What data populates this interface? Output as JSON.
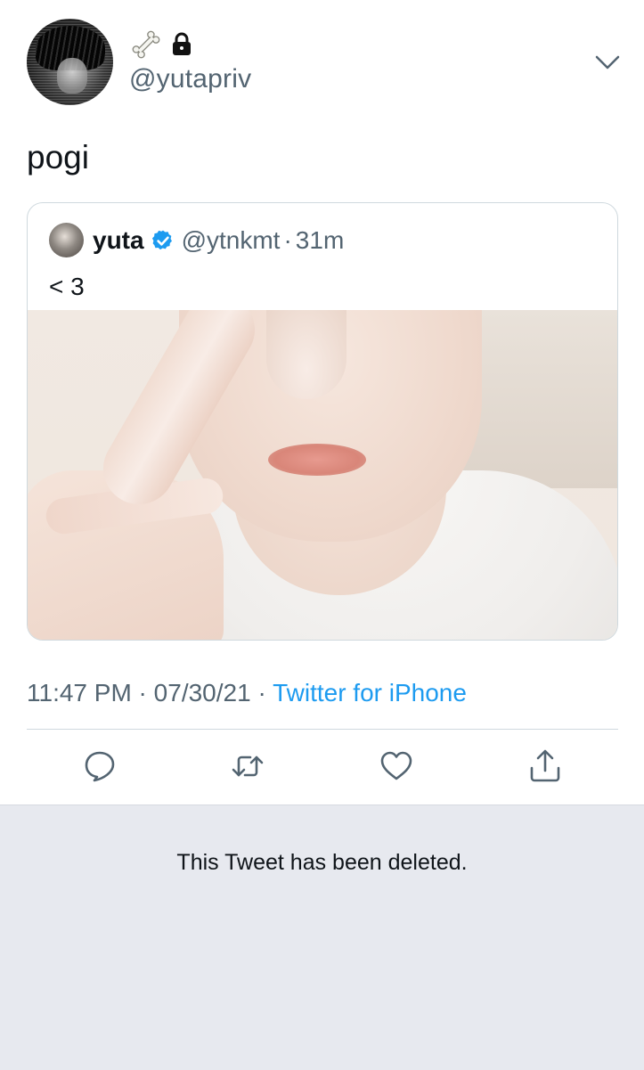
{
  "author": {
    "handle": "@yutapriv",
    "name_icons": [
      "bone-icon",
      "lock-icon"
    ]
  },
  "tweet": {
    "text": "pogi"
  },
  "quoted_tweet": {
    "name": "yuta",
    "handle": "@ytnkmt",
    "separator": "·",
    "time": "31m",
    "text": "< 3",
    "verified_color": "#1d9bf0"
  },
  "meta": {
    "time": "11:47 PM",
    "sep1": " · ",
    "date": "07/30/21",
    "sep2": " · ",
    "source": "Twitter for iPhone"
  },
  "actions": [
    "reply-icon",
    "retweet-icon",
    "like-icon",
    "share-icon"
  ],
  "deleted_notice": {
    "text": "This Tweet has been deleted."
  },
  "colors": {
    "accent": "#1d9bf0",
    "secondary_text": "#536471",
    "deleted_bg": "#e7e9ef"
  }
}
